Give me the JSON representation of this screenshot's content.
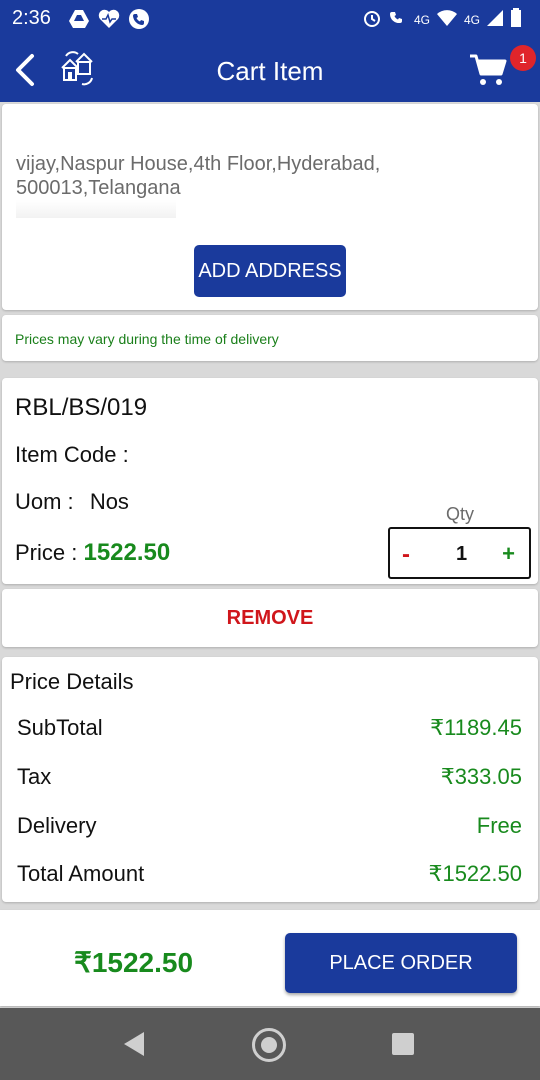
{
  "status_bar": {
    "time": "2:36",
    "network_label_1": "4G",
    "network_label_2": "4G"
  },
  "app_bar": {
    "title": "Cart Item",
    "cart_badge": "1"
  },
  "address": {
    "text": "vijay,Naspur House,4th Floor,Hyderabad, 500013,Telangana",
    "add_button": "ADD ADDRESS"
  },
  "notice": "Prices may vary during the time of delivery",
  "item": {
    "code": "RBL/BS/019",
    "item_code_label": "Item Code :",
    "uom_label": "Uom :",
    "uom_value": "Nos",
    "price_label": "Price :",
    "price_value": "1522.50",
    "qty_label": "Qty",
    "qty_minus": "-",
    "qty_value": "1",
    "qty_plus": "+"
  },
  "remove_label": "REMOVE",
  "price_details": {
    "title": "Price Details",
    "rows": [
      {
        "label": "SubTotal",
        "value": "₹1189.45"
      },
      {
        "label": "Tax",
        "value": "₹333.05"
      },
      {
        "label": "Delivery",
        "value": "Free"
      },
      {
        "label": "Total Amount",
        "value": "₹1522.50"
      }
    ]
  },
  "footer": {
    "total": "₹1522.50",
    "place_order": "PLACE ORDER"
  },
  "colors": {
    "primary": "#1a3a9c",
    "green": "#188a1d",
    "red": "#d0161b"
  }
}
